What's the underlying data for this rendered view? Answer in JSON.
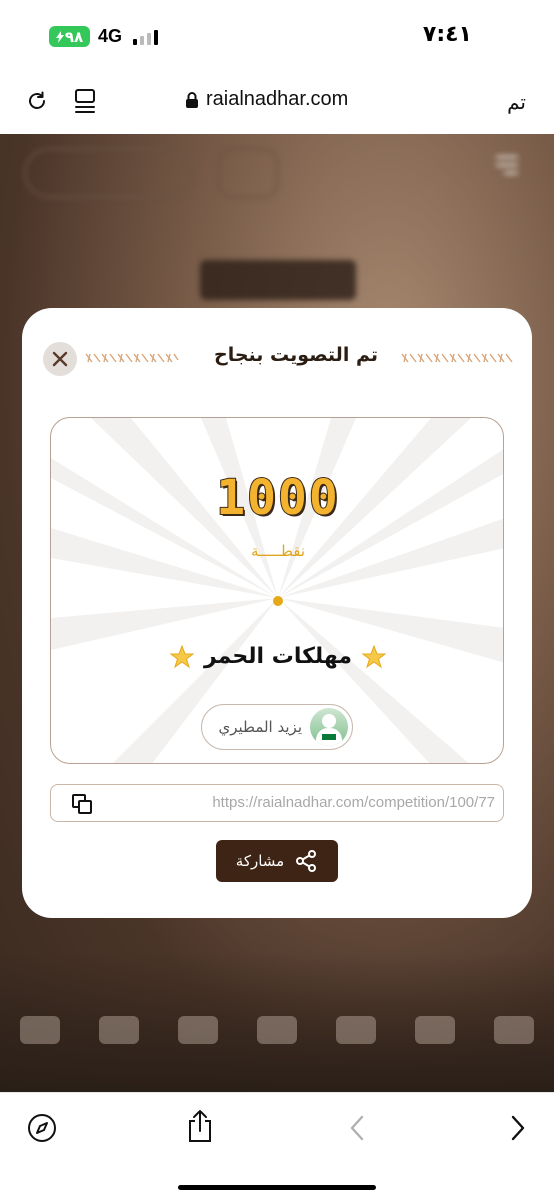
{
  "status_bar": {
    "battery": "٩٨",
    "network": "4G",
    "time": "٧:٤١"
  },
  "browser": {
    "url": "raialnadhar.com",
    "done_label": "تم"
  },
  "modal": {
    "title": "تم التصويت بنجاح",
    "points": "1000",
    "points_unit": "نقطـــــة",
    "nominee": "مهلكات الحمر",
    "voter_name": "يزيد المطيري",
    "share_link": "https://raialnadhar.com/competition/100/77",
    "share_label": "مشاركة"
  },
  "colors": {
    "accent_gold": "#f4b32f",
    "brand_brown": "#3e2415"
  }
}
